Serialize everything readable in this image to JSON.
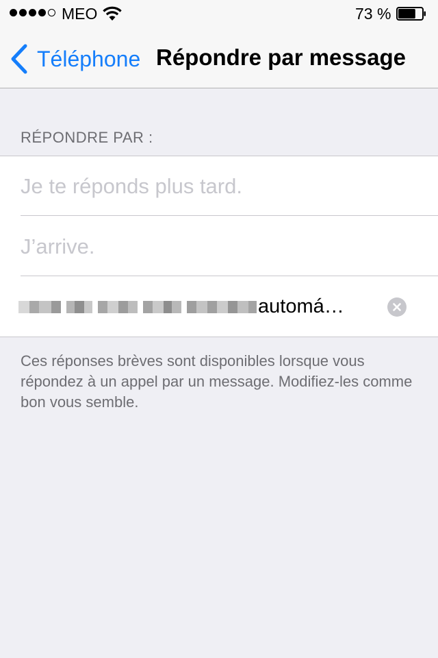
{
  "status_bar": {
    "carrier": "MEO",
    "battery_percent": "73 %",
    "battery_level": 0.73,
    "signal_bars_filled": 4,
    "signal_bars_total": 5
  },
  "nav": {
    "back_label": "Téléphone",
    "title": "Répondre par message"
  },
  "section": {
    "header": "RÉPONDRE PAR :",
    "rows": [
      {
        "placeholder": "Je te réponds plus tard."
      },
      {
        "placeholder": "J’arrive."
      },
      {
        "value_visible_suffix": "automá…"
      }
    ],
    "footer": "Ces réponses brèves sont disponibles lorsque vous répondez à un appel par un message. Modifiez-les comme bon vous semble."
  },
  "colors": {
    "accent": "#157efb",
    "background": "#efeff4",
    "placeholder": "#c7c7cd"
  }
}
